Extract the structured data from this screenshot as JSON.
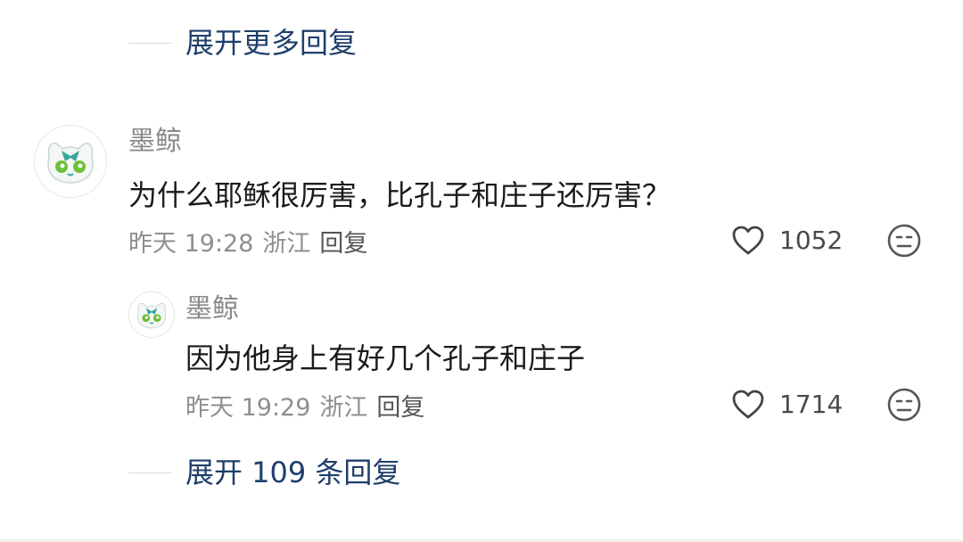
{
  "top_expand": {
    "label": "展开更多回复"
  },
  "comment": {
    "username": "墨鲸",
    "text": "为什么耶稣很厉害，比孔子和庄子还厉害？",
    "time": "昨天 19:28",
    "location": "浙江",
    "reply_label": "回复",
    "likes": "1052"
  },
  "reply": {
    "username": "墨鲸",
    "text": "因为他身上有好几个孔子和庄子",
    "time": "昨天 19:29",
    "location": "浙江",
    "reply_label": "回复",
    "likes": "1714"
  },
  "bottom_expand": {
    "label": "展开 109 条回复"
  },
  "icons": {
    "like": "heart-outline-icon",
    "dislike": "meh-face-icon"
  },
  "colors": {
    "link": "#1f3f6b",
    "username": "#8a8a8a",
    "text": "#1a1a1a",
    "meta": "#8f8f8f"
  }
}
